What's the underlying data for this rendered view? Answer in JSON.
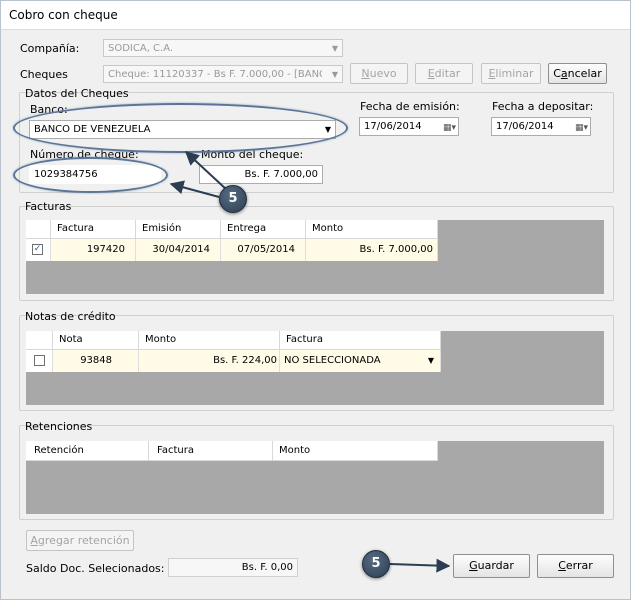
{
  "window": {
    "title": "Cobro con cheque"
  },
  "top": {
    "compania_label": "Compañía:",
    "compania_value": "SODICA, C.A.",
    "cheques_label": "Cheques",
    "cheques_value": "Cheque: 11120337 - Bs F. 7.000,00 - [BANC",
    "nuevo_label": "Nuevo",
    "editar_label": "Editar",
    "eliminar_label": "Eliminar",
    "cancelar_label": "Cancelar"
  },
  "datos": {
    "group_title": "Datos del Cheques",
    "banco_label": "Banco:",
    "banco_value": "BANCO DE VENEZUELA",
    "fecha_emision_label": "Fecha de emisión:",
    "fecha_emision_value": "17/06/2014",
    "fecha_depositar_label": "Fecha a depositar:",
    "fecha_depositar_value": "17/06/2014",
    "numero_label": "Número de cheque:",
    "numero_value": "1029384756",
    "monto_label": "Monto del cheque:",
    "monto_value": "Bs. F. 7.000,00"
  },
  "facturas": {
    "group_title": "Facturas",
    "columns": [
      "Factura",
      "Emisión",
      "Entrega",
      "Monto"
    ],
    "rows": [
      {
        "checked": true,
        "factura": "197420",
        "emision": "30/04/2014",
        "entrega": "07/05/2014",
        "monto": "Bs. F. 7.000,00"
      }
    ]
  },
  "notas": {
    "group_title": "Notas de crédito",
    "columns": [
      "Nota",
      "Monto",
      "Factura"
    ],
    "rows": [
      {
        "checked": false,
        "nota": "93848",
        "monto": "Bs. F. 224,00",
        "factura": "NO SELECCIONADA"
      }
    ]
  },
  "retenciones": {
    "group_title": "Retenciones",
    "columns": [
      "Retención",
      "Factura",
      "Monto"
    ]
  },
  "bottom": {
    "agregar_label": "Agregar retención",
    "saldo_label": "Saldo Doc. Selecionados:",
    "saldo_value": "Bs. F. 0,00",
    "guardar_label": "Guardar",
    "cerrar_label": "Cerrar"
  },
  "callouts": {
    "badge_1": "5",
    "badge_2": "5"
  },
  "colors": {
    "row_highlight": "#fffbe6",
    "grid_background": "#a8a8a8",
    "callout_outline": "#5b7596",
    "badge_fill": "#2c3d52"
  }
}
